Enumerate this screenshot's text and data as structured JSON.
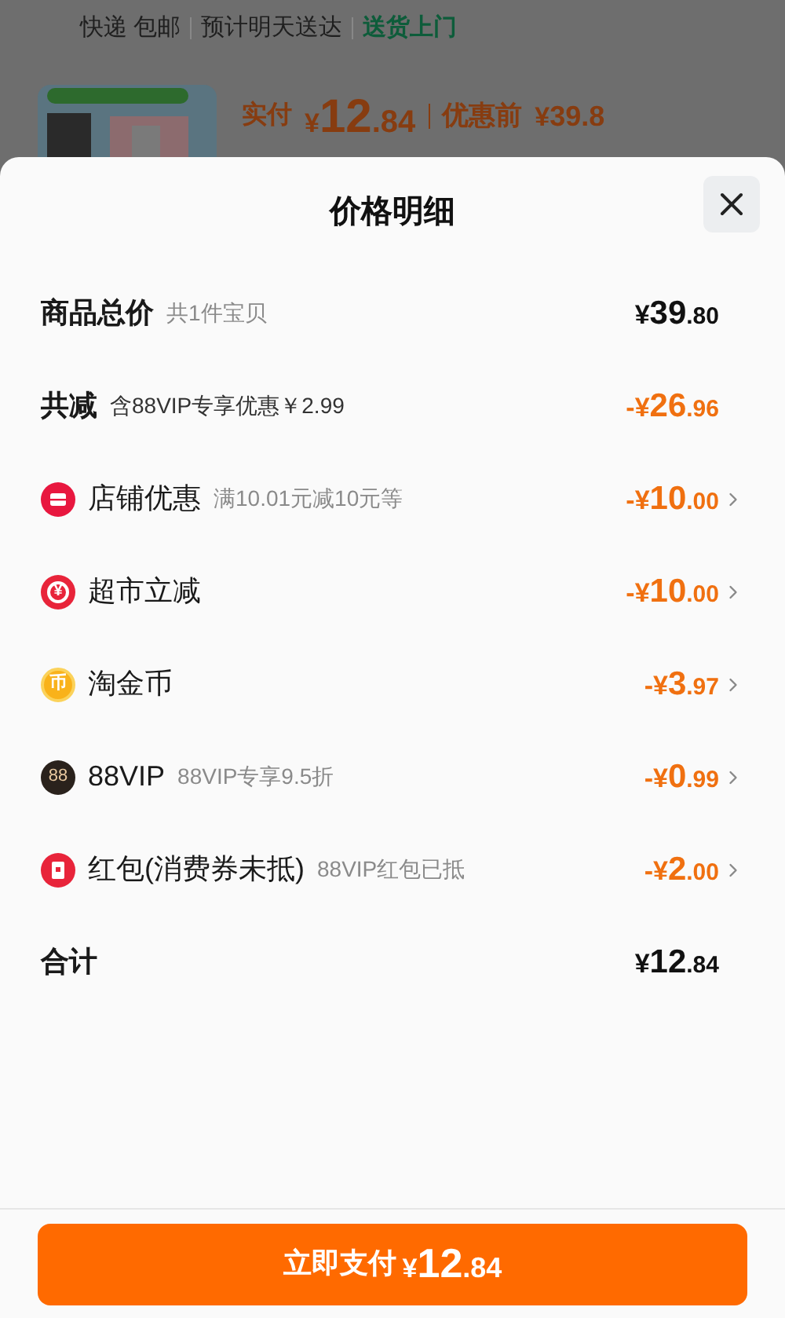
{
  "background": {
    "shipping": [
      "快递 包邮",
      "预计明天送达"
    ],
    "delivery": "送货上门",
    "paid_label": "实付",
    "paid": "¥12.84",
    "before_label": "优惠前",
    "before": "¥39.8"
  },
  "sheet": {
    "title": "价格明细",
    "rows": [
      {
        "kind": "total",
        "label": "商品总价",
        "note": "共1件宝贝",
        "amount": "¥39.80",
        "arrow": false
      },
      {
        "kind": "discount",
        "label": "共减",
        "note": "含88VIP专享优惠￥2.99",
        "amount": "-¥26.96",
        "arrow": false
      },
      {
        "kind": "item",
        "label": "店铺优惠",
        "note": "满10.01元减10元等",
        "amount": "-¥10.00",
        "arrow": true
      },
      {
        "kind": "item",
        "icon_text": "¥",
        "label": "超市立减",
        "amount": "-¥10.00",
        "arrow": true
      },
      {
        "kind": "item",
        "icon_text": "币",
        "label": "淘金币",
        "amount": "-¥3.97",
        "arrow": true
      },
      {
        "kind": "item",
        "icon_text": "88",
        "label": "88VIP",
        "note": "88VIP专享9.5折",
        "amount": "-¥0.99",
        "arrow": true
      },
      {
        "kind": "item",
        "label": "红包(消费券未抵)",
        "note": "88VIP红包已抵",
        "amount": "-¥2.00",
        "arrow": true
      },
      {
        "kind": "sum",
        "label": "合计",
        "amount": "¥12.84",
        "arrow": false
      }
    ],
    "pay_button": {
      "label": "立即支付",
      "amount": "¥12.84"
    }
  }
}
